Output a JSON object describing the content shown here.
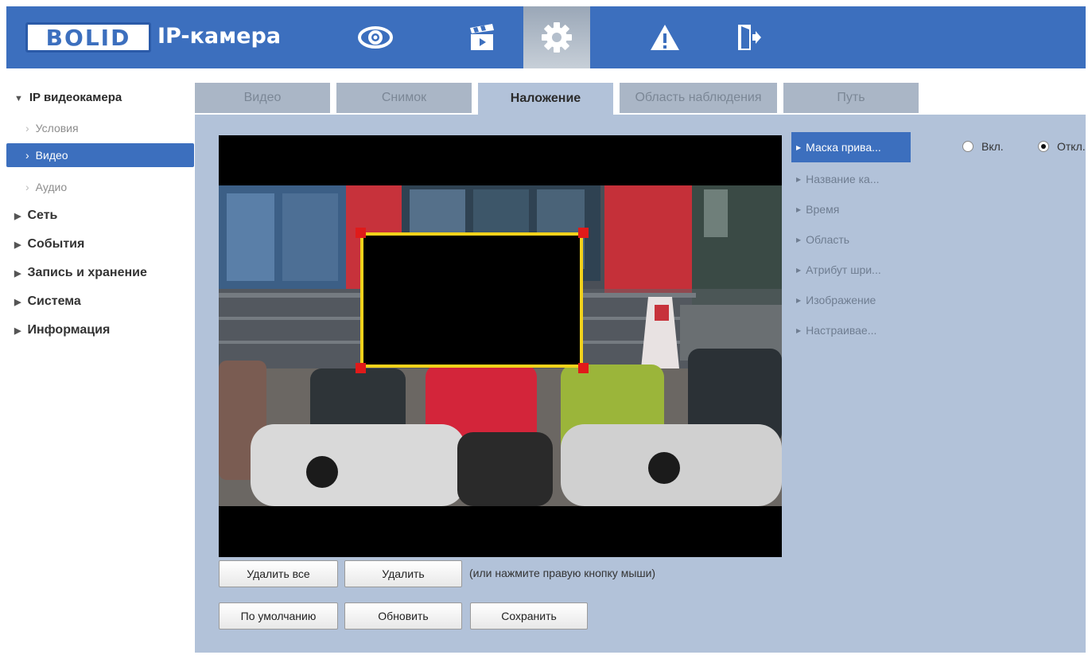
{
  "header": {
    "logo_text": "BOLID",
    "app_title": "IP-камера",
    "nav_icons": [
      "eye-icon",
      "clapperboard-icon",
      "gear-icon",
      "warning-icon",
      "exit-icon"
    ],
    "active_nav": "gear-icon",
    "accent_color": "#3c6fbe"
  },
  "sidebar": {
    "root_label": "IP видеокамера",
    "subitems": [
      {
        "label": "Условия"
      },
      {
        "label": "Видео",
        "active": true
      },
      {
        "label": "Аудио"
      }
    ],
    "items": [
      {
        "label": "Сеть"
      },
      {
        "label": "События"
      },
      {
        "label": "Запись и хранение"
      },
      {
        "label": "Система"
      },
      {
        "label": "Информация"
      }
    ]
  },
  "tabs": [
    {
      "label": "Видео"
    },
    {
      "label": "Снимок"
    },
    {
      "label": "Наложение",
      "active": true
    },
    {
      "label": "Область наблюдения"
    },
    {
      "label": "Путь"
    }
  ],
  "submenu": [
    {
      "label": "Маска прива...",
      "active": true
    },
    {
      "label": "Название ка..."
    },
    {
      "label": "Время"
    },
    {
      "label": "Область"
    },
    {
      "label": "Атрибут шри..."
    },
    {
      "label": "Изображение"
    },
    {
      "label": "Настраивае..."
    }
  ],
  "toggle": {
    "on_label": "Вкл.",
    "off_label": "Откл.",
    "selected": "off"
  },
  "buttons": {
    "delete_all": "Удалить все",
    "delete": "Удалить",
    "default": "По умолчанию",
    "refresh": "Обновить",
    "save": "Сохранить"
  },
  "hint": "(или нажмите правую кнопку мыши)",
  "mask_color": "#f3d21b",
  "handle_color": "#e01a1a"
}
